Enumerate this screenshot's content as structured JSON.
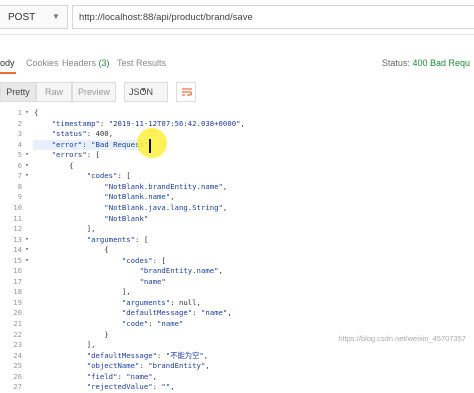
{
  "request": {
    "method": "POST",
    "url": "http://localhost:88/api/product/brand/save"
  },
  "response_tabs": [
    {
      "label": "ody"
    },
    {
      "label": "Cookies"
    },
    {
      "label": "Headers",
      "count": "(3)"
    },
    {
      "label": "Test Results"
    }
  ],
  "status": {
    "label": "Status:",
    "value": "400 Bad Requ"
  },
  "toolbar": {
    "pretty": "Pretty",
    "raw": "Raw",
    "preview": "Preview",
    "format": "JSON"
  },
  "code_lines": [
    {
      "n": "1",
      "fold": "▾",
      "text": "{"
    },
    {
      "n": "2",
      "fold": "",
      "text": "    \"timestamp\": \"2019-11-12T07:56:42.038+0000\","
    },
    {
      "n": "3",
      "fold": "",
      "text": "    \"status\": 400,"
    },
    {
      "n": "4",
      "fold": "",
      "text": "    \"error\": \"Bad Request\","
    },
    {
      "n": "5",
      "fold": "▾",
      "text": "    \"errors\": ["
    },
    {
      "n": "6",
      "fold": "▾",
      "text": "        {"
    },
    {
      "n": "7",
      "fold": "▾",
      "text": "            \"codes\": ["
    },
    {
      "n": "8",
      "fold": "",
      "text": "                \"NotBlank.brandEntity.name\","
    },
    {
      "n": "9",
      "fold": "",
      "text": "                \"NotBlank.name\","
    },
    {
      "n": "10",
      "fold": "",
      "text": "                \"NotBlank.java.lang.String\","
    },
    {
      "n": "11",
      "fold": "",
      "text": "                \"NotBlank\""
    },
    {
      "n": "12",
      "fold": "",
      "text": "            ],"
    },
    {
      "n": "13",
      "fold": "▾",
      "text": "            \"arguments\": ["
    },
    {
      "n": "14",
      "fold": "▾",
      "text": "                {"
    },
    {
      "n": "15",
      "fold": "▾",
      "text": "                    \"codes\": ["
    },
    {
      "n": "16",
      "fold": "",
      "text": "                        \"brandEntity.name\","
    },
    {
      "n": "17",
      "fold": "",
      "text": "                        \"name\""
    },
    {
      "n": "18",
      "fold": "",
      "text": "                    ],"
    },
    {
      "n": "19",
      "fold": "",
      "text": "                    \"arguments\": null,"
    },
    {
      "n": "20",
      "fold": "",
      "text": "                    \"defaultMessage\": \"name\","
    },
    {
      "n": "21",
      "fold": "",
      "text": "                    \"code\": \"name\""
    },
    {
      "n": "22",
      "fold": "",
      "text": "                }"
    },
    {
      "n": "23",
      "fold": "",
      "text": "            ],"
    },
    {
      "n": "24",
      "fold": "",
      "text": "            \"defaultMessage\": \"不能为空\","
    },
    {
      "n": "25",
      "fold": "",
      "text": "            \"objectName\": \"brandEntity\","
    },
    {
      "n": "26",
      "fold": "",
      "text": "            \"field\": \"name\","
    },
    {
      "n": "27",
      "fold": "",
      "text": "            \"rejectedValue\": \"\","
    }
  ],
  "watermark": "https://blog.csdn.net/weixin_45707357",
  "icons": {
    "method_caret": "chevron-down-icon",
    "format_caret": "chevron-down-icon",
    "wrap": "wrap-lines-icon"
  },
  "colors": {
    "accent": "#f26b3a",
    "status_ok": "#1c8c3a",
    "json_string": "#1b3fa4",
    "highlight": "#e8f0fe",
    "cursor_ring": "#fff03c"
  }
}
